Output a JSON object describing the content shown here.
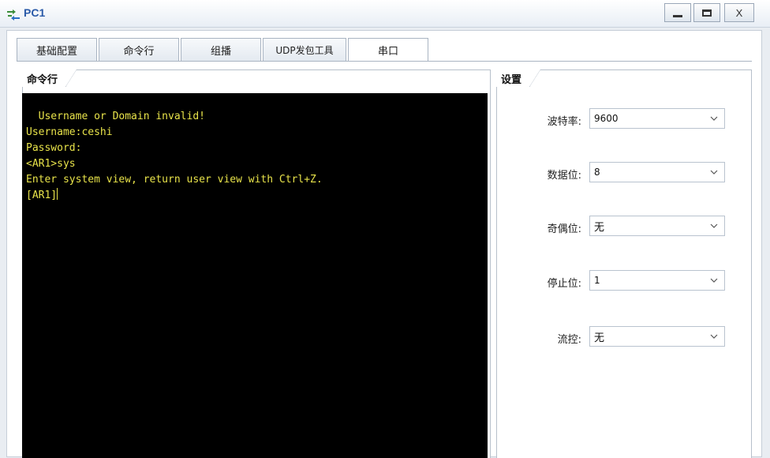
{
  "window": {
    "title": "PC1",
    "minimize": "_",
    "close_label": "X"
  },
  "tabs": [
    "基础配置",
    "命令行",
    "组播",
    "UDP发包工具",
    "串口"
  ],
  "command_group": {
    "label": "命令行"
  },
  "terminal": {
    "lines": [
      "  Username or Domain invalid!",
      "Username:ceshi",
      "Password:",
      "<AR1>sys",
      "Enter system view, return user view with Ctrl+Z.",
      "[AR1]"
    ]
  },
  "settings": {
    "label": "设置",
    "fields": [
      {
        "label": "波特率:",
        "value": "9600"
      },
      {
        "label": "数据位:",
        "value": "8"
      },
      {
        "label": "奇偶位:",
        "value": "无"
      },
      {
        "label": "停止位:",
        "value": "1"
      },
      {
        "label": "流控:",
        "value": "无"
      }
    ]
  },
  "colors": {
    "terminal_bg": "#000000",
    "terminal_text": "#e8e34a",
    "title_text": "#2a5aa8"
  }
}
